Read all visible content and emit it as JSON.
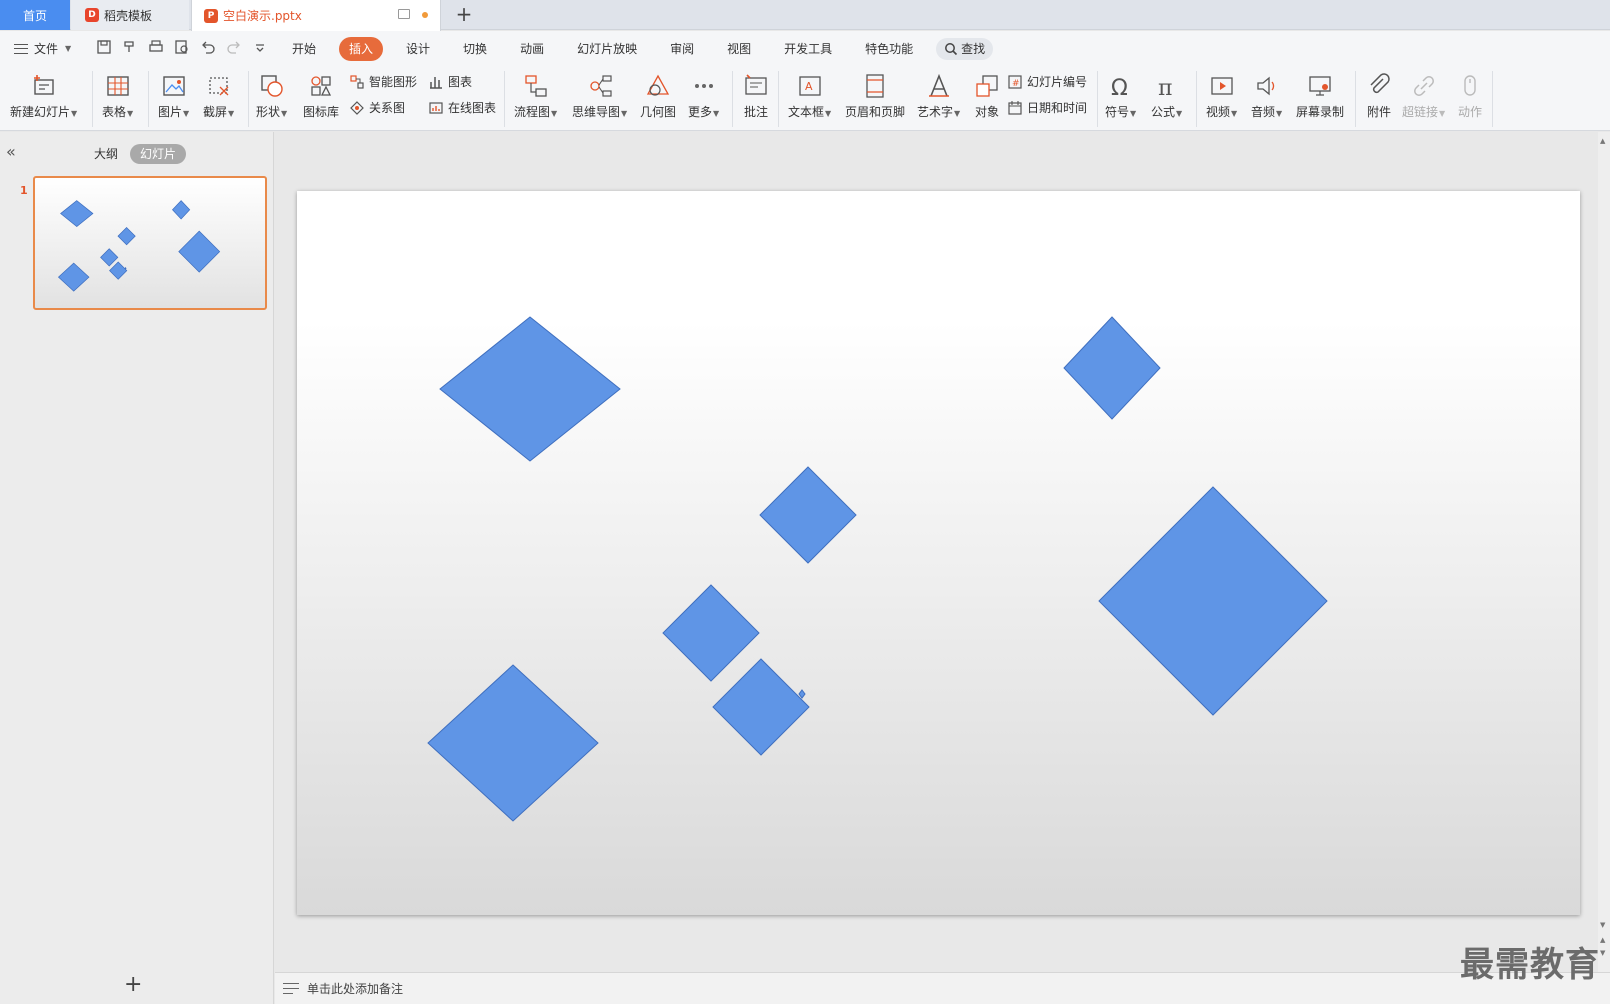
{
  "tabs": {
    "home": "首页",
    "template": "稻壳模板",
    "document": "空白演示.pptx",
    "new_tab_symbol": "+"
  },
  "menu": {
    "file_label": "文件",
    "tabs": [
      "开始",
      "插入",
      "设计",
      "切换",
      "动画",
      "幻灯片放映",
      "审阅",
      "视图",
      "开发工具",
      "特色功能"
    ],
    "active_tab": "插入",
    "search_label": "查找"
  },
  "ribbon": {
    "new_slide": "新建幻灯片",
    "table": "表格",
    "picture": "图片",
    "screenshot": "截屏",
    "shape": "形状",
    "icon_library": "图标库",
    "smart_art": "智能图形",
    "relation": "关系图",
    "chart": "图表",
    "online_chart": "在线图表",
    "flowchart": "流程图",
    "mindmap": "思维导图",
    "geometry": "几何图",
    "more": "更多",
    "comment": "批注",
    "textbox": "文本框",
    "header_footer": "页眉和页脚",
    "wordart": "艺术字",
    "object": "对象",
    "slide_number": "幻灯片编号",
    "datetime": "日期和时间",
    "symbol": "符号",
    "formula": "公式",
    "video": "视频",
    "audio": "音频",
    "screen_record": "屏幕录制",
    "attachment": "附件",
    "hyperlink": "超链接",
    "action": "动作"
  },
  "panel": {
    "outline_tab": "大纲",
    "slides_tab": "幻灯片",
    "slide_number": "1",
    "add_slide_symbol": "+"
  },
  "slide": {
    "shape_fill": "#5f95e6",
    "shape_stroke": "#3f6fbf",
    "diamond_count": 9
  },
  "notes": {
    "placeholder": "单击此处添加备注"
  },
  "watermark": "最需教育",
  "colors": {
    "accent": "#e76b3b",
    "home_tab": "#4a8df0",
    "thumb_border": "#e98a4a"
  }
}
